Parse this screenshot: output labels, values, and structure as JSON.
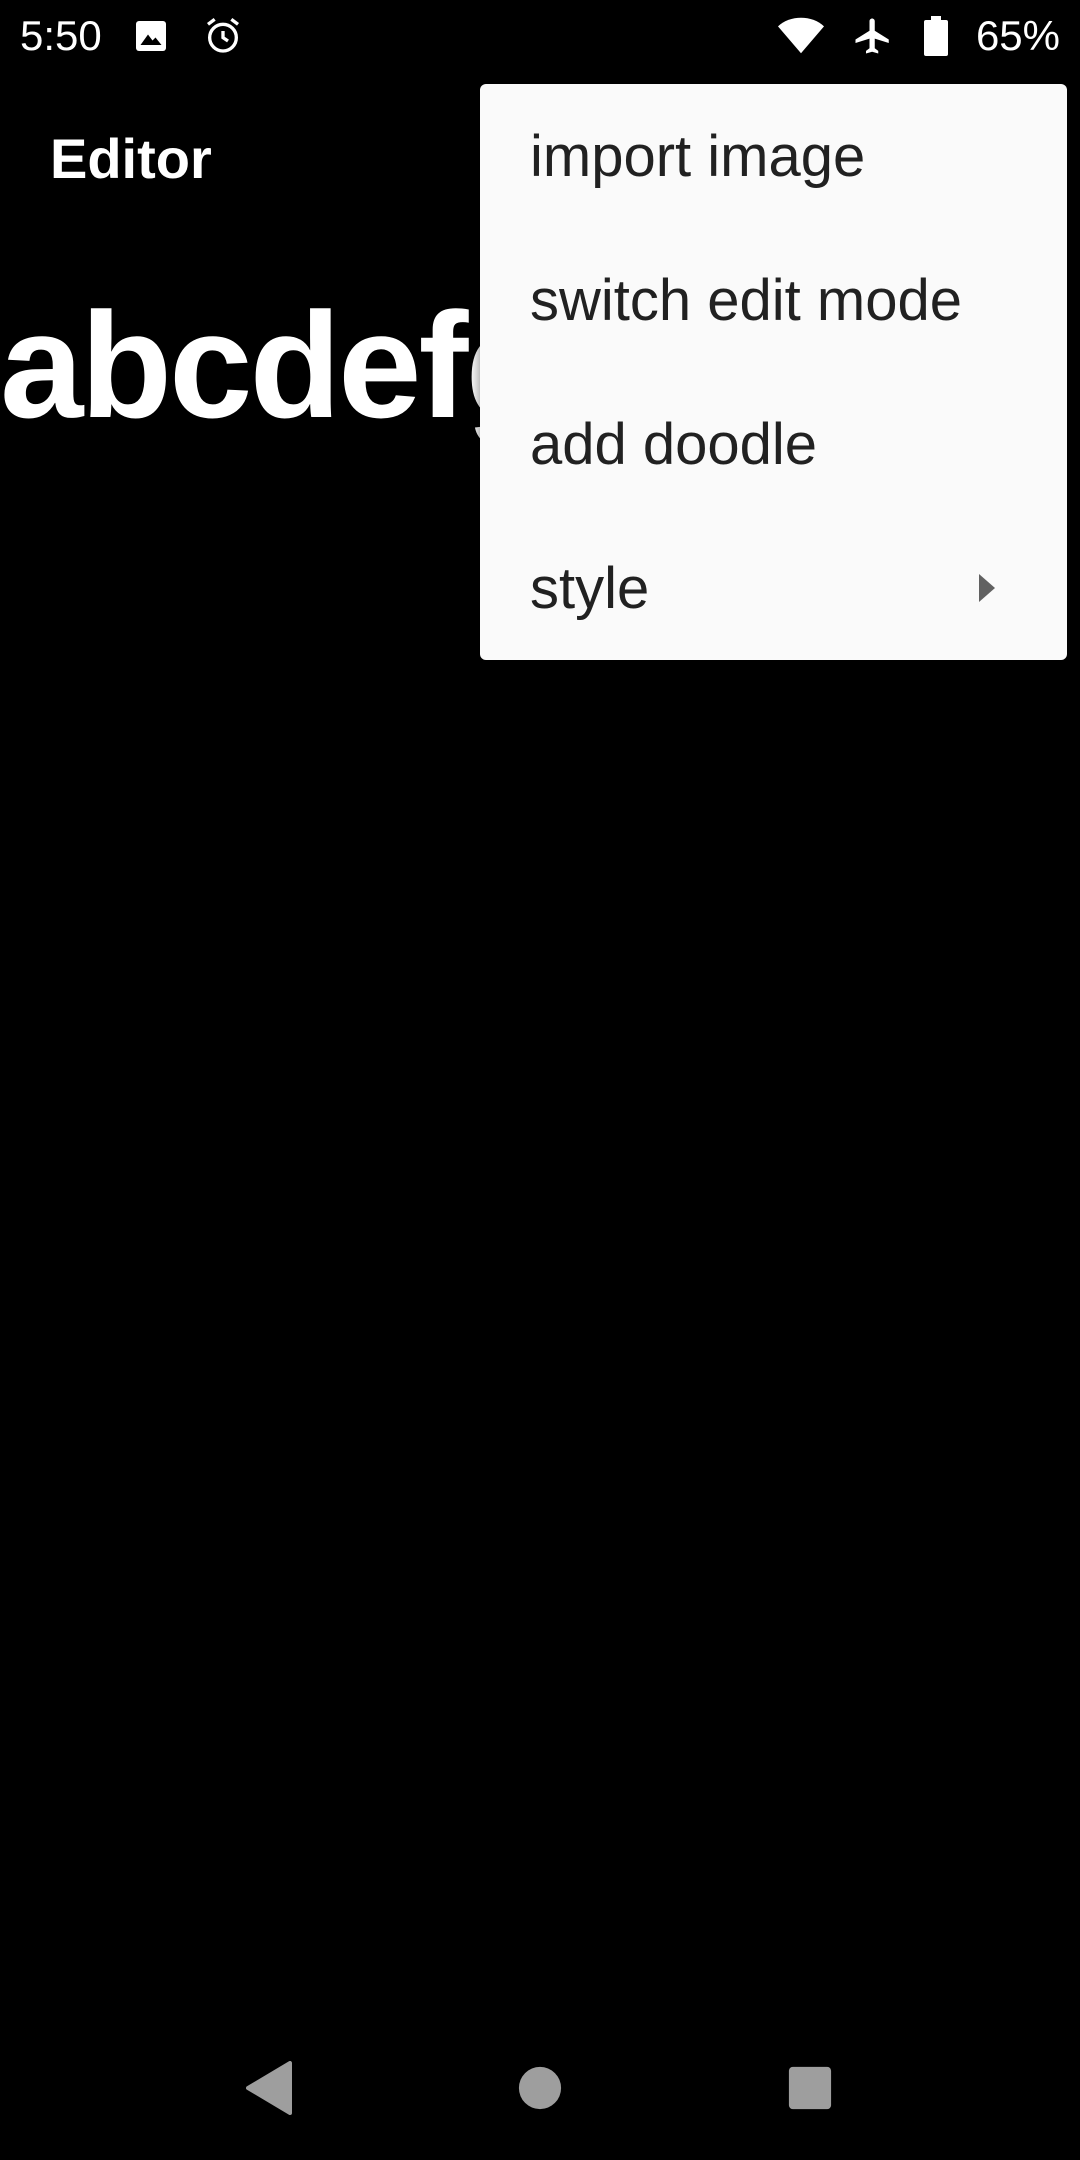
{
  "status_bar": {
    "time": "5:50",
    "battery_percent": "65%",
    "icons_left": [
      "image-icon",
      "alarm-icon"
    ],
    "icons_right": [
      "wifi-icon",
      "airplane-icon",
      "battery-icon"
    ]
  },
  "app_bar": {
    "title": "Editor"
  },
  "editor": {
    "content": "abcdefg"
  },
  "overflow_menu": {
    "items": [
      {
        "label": "import image",
        "has_submenu": false
      },
      {
        "label": "switch edit mode",
        "has_submenu": false
      },
      {
        "label": "add doodle",
        "has_submenu": false
      },
      {
        "label": "style",
        "has_submenu": true
      }
    ]
  },
  "nav_bar": {
    "buttons": [
      "back-icon",
      "home-icon",
      "recents-icon"
    ]
  },
  "colors": {
    "background": "#000000",
    "menu_background": "#fafafa",
    "menu_text": "#212121",
    "foreground": "#ffffff",
    "nav_icon": "#9e9e9e"
  }
}
